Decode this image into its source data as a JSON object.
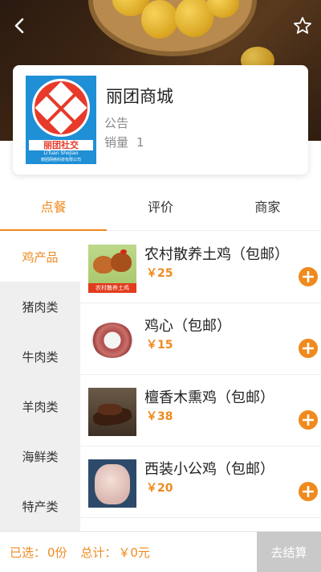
{
  "shop": {
    "name": "丽团商城",
    "notice_label": "公告",
    "sales_label": "销量",
    "sales_count": "1",
    "logo_text_cn": "丽团社交",
    "logo_text_en": "LiTuan SheJiao",
    "logo_company": "丽团网络科技有限公司"
  },
  "tabs": [
    {
      "label": "点餐",
      "active": true
    },
    {
      "label": "评价",
      "active": false
    },
    {
      "label": "商家",
      "active": false
    }
  ],
  "categories": [
    {
      "label": "鸡产品",
      "active": true
    },
    {
      "label": "猪肉类",
      "active": false
    },
    {
      "label": "牛肉类",
      "active": false
    },
    {
      "label": "羊肉类",
      "active": false
    },
    {
      "label": "海鲜类",
      "active": false
    },
    {
      "label": "特产类",
      "active": false
    }
  ],
  "products": [
    {
      "name": "农村散养土鸡（包邮）",
      "price": "￥25",
      "thumb_tag": "农村散养土鸡"
    },
    {
      "name": "鸡心（包邮）",
      "price": "￥15"
    },
    {
      "name": "檀香木熏鸡（包邮）",
      "price": "￥38"
    },
    {
      "name": "西装小公鸡（包邮）",
      "price": "￥20"
    }
  ],
  "footer": {
    "selected_label": "已选：",
    "selected_value": "0份",
    "total_label": "总计：",
    "total_value": "￥0元",
    "checkout_label": "去结算"
  },
  "colors": {
    "accent": "#ef8a1e",
    "sidebar_bg": "#efefef",
    "checkout_disabled": "#c9c9c9"
  },
  "icons": {
    "back": "chevron-left-icon",
    "favorite": "star-outline-icon",
    "add": "plus-circle-icon"
  }
}
